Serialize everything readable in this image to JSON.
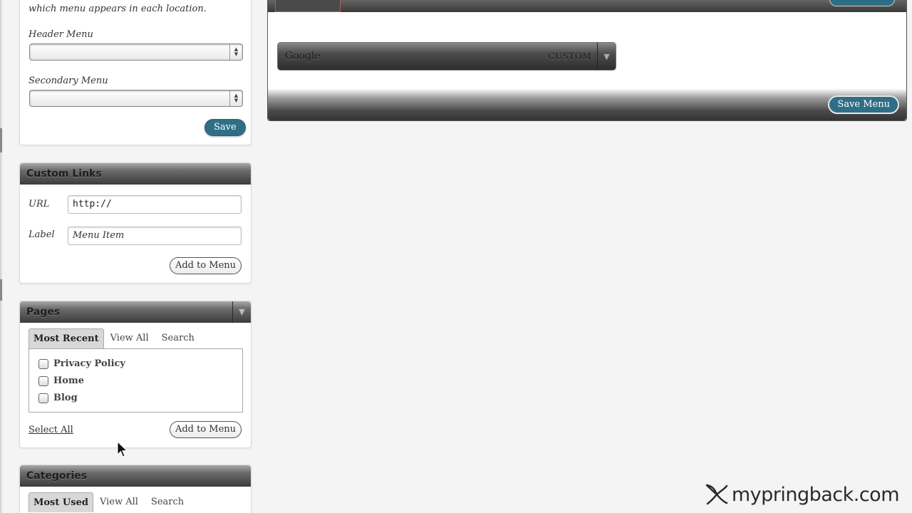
{
  "theme_locations": {
    "intro_text": "which menu appears in each location.",
    "header_menu_label": "Header Menu",
    "header_menu_value": "",
    "secondary_menu_label": "Secondary Menu",
    "secondary_menu_value": "",
    "save_label": "Save"
  },
  "custom_links": {
    "title": "Custom Links",
    "url_label": "URL",
    "url_value": "http://",
    "label_label": "Label",
    "label_placeholder": "Menu Item",
    "add_label": "Add to Menu"
  },
  "pages": {
    "title": "Pages",
    "tabs": [
      "Most Recent",
      "View All",
      "Search"
    ],
    "active_tab": "Most Recent",
    "items": [
      "Privacy Policy",
      "Home",
      "Blog"
    ],
    "select_all_label": "Select All",
    "add_label": "Add to Menu"
  },
  "categories": {
    "title": "Categories",
    "tabs": [
      "Most Used",
      "View All",
      "Search"
    ],
    "active_tab": "Most Used"
  },
  "menu_editor": {
    "items": [
      {
        "title": "Google",
        "type": "CUSTOM"
      }
    ],
    "save_menu_label": "Save Menu"
  },
  "watermark": {
    "text": "mypringback.com"
  },
  "colors": {
    "accent_button": "#2f6f86",
    "panel_header_dark": "#3c3c3c"
  }
}
